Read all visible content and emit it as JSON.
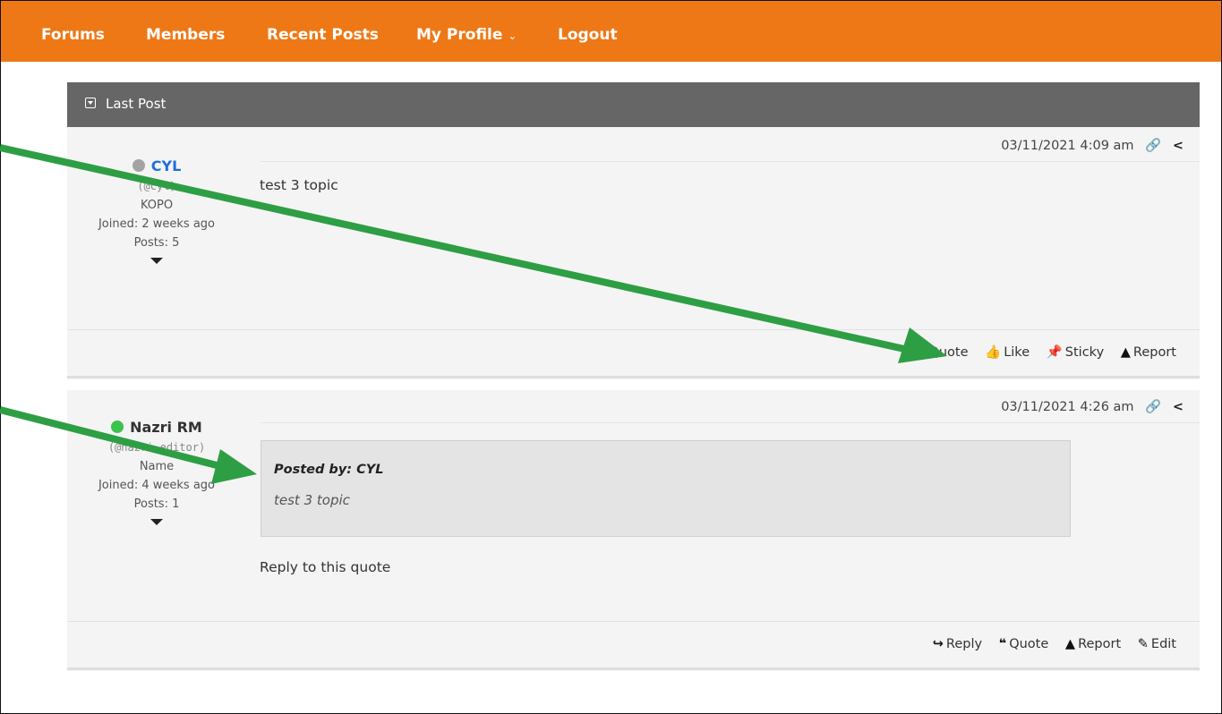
{
  "nav": {
    "items": [
      {
        "label": "Forums"
      },
      {
        "label": "Members"
      },
      {
        "label": "Recent Posts"
      },
      {
        "label": "My Profile"
      },
      {
        "label": "Logout"
      }
    ],
    "dropdown_chevron": "⌄"
  },
  "panel": {
    "title": "Last Post"
  },
  "posts": [
    {
      "author": {
        "name": "CYL",
        "handle": "(@cyl)",
        "role": "KOPO",
        "joined": "Joined: 2 weeks ago",
        "posts": "Posts: 5",
        "status_color": "#a3a3a3",
        "name_color": "#1e6fd9"
      },
      "date": "03/11/2021 4:09 am",
      "content": "test 3 topic",
      "actions": [
        {
          "icon": "quote-icon",
          "label": "Quote"
        },
        {
          "icon": "thumbs-up-icon",
          "label": "Like",
          "glyph": "👍"
        },
        {
          "icon": "pin-icon",
          "label": "Sticky",
          "glyph": "📌"
        },
        {
          "icon": "warning-icon",
          "label": "Report",
          "glyph": "▲"
        }
      ]
    },
    {
      "author": {
        "name": "Nazri RM",
        "handle": "(@nazri-editor)",
        "role": "Name",
        "joined": "Joined: 4 weeks ago",
        "posts": "Posts: 1",
        "status_color": "#3cc24f",
        "name_color": "#333333"
      },
      "date": "03/11/2021 4:26 am",
      "quote": {
        "by": "Posted by: CYL",
        "text": "test 3 topic"
      },
      "content": "Reply to this quote",
      "actions": [
        {
          "icon": "reply-icon",
          "label": "Reply",
          "glyph": "↪"
        },
        {
          "icon": "quote-icon",
          "label": "Quote",
          "glyph": "❝"
        },
        {
          "icon": "warning-icon",
          "label": "Report",
          "glyph": "▲"
        },
        {
          "icon": "edit-icon",
          "label": "Edit",
          "glyph": "✎"
        }
      ]
    }
  ],
  "colors": {
    "nav_bg": "#ee7816",
    "panel_head_bg": "#666666",
    "arrow": "#2e9e44"
  }
}
